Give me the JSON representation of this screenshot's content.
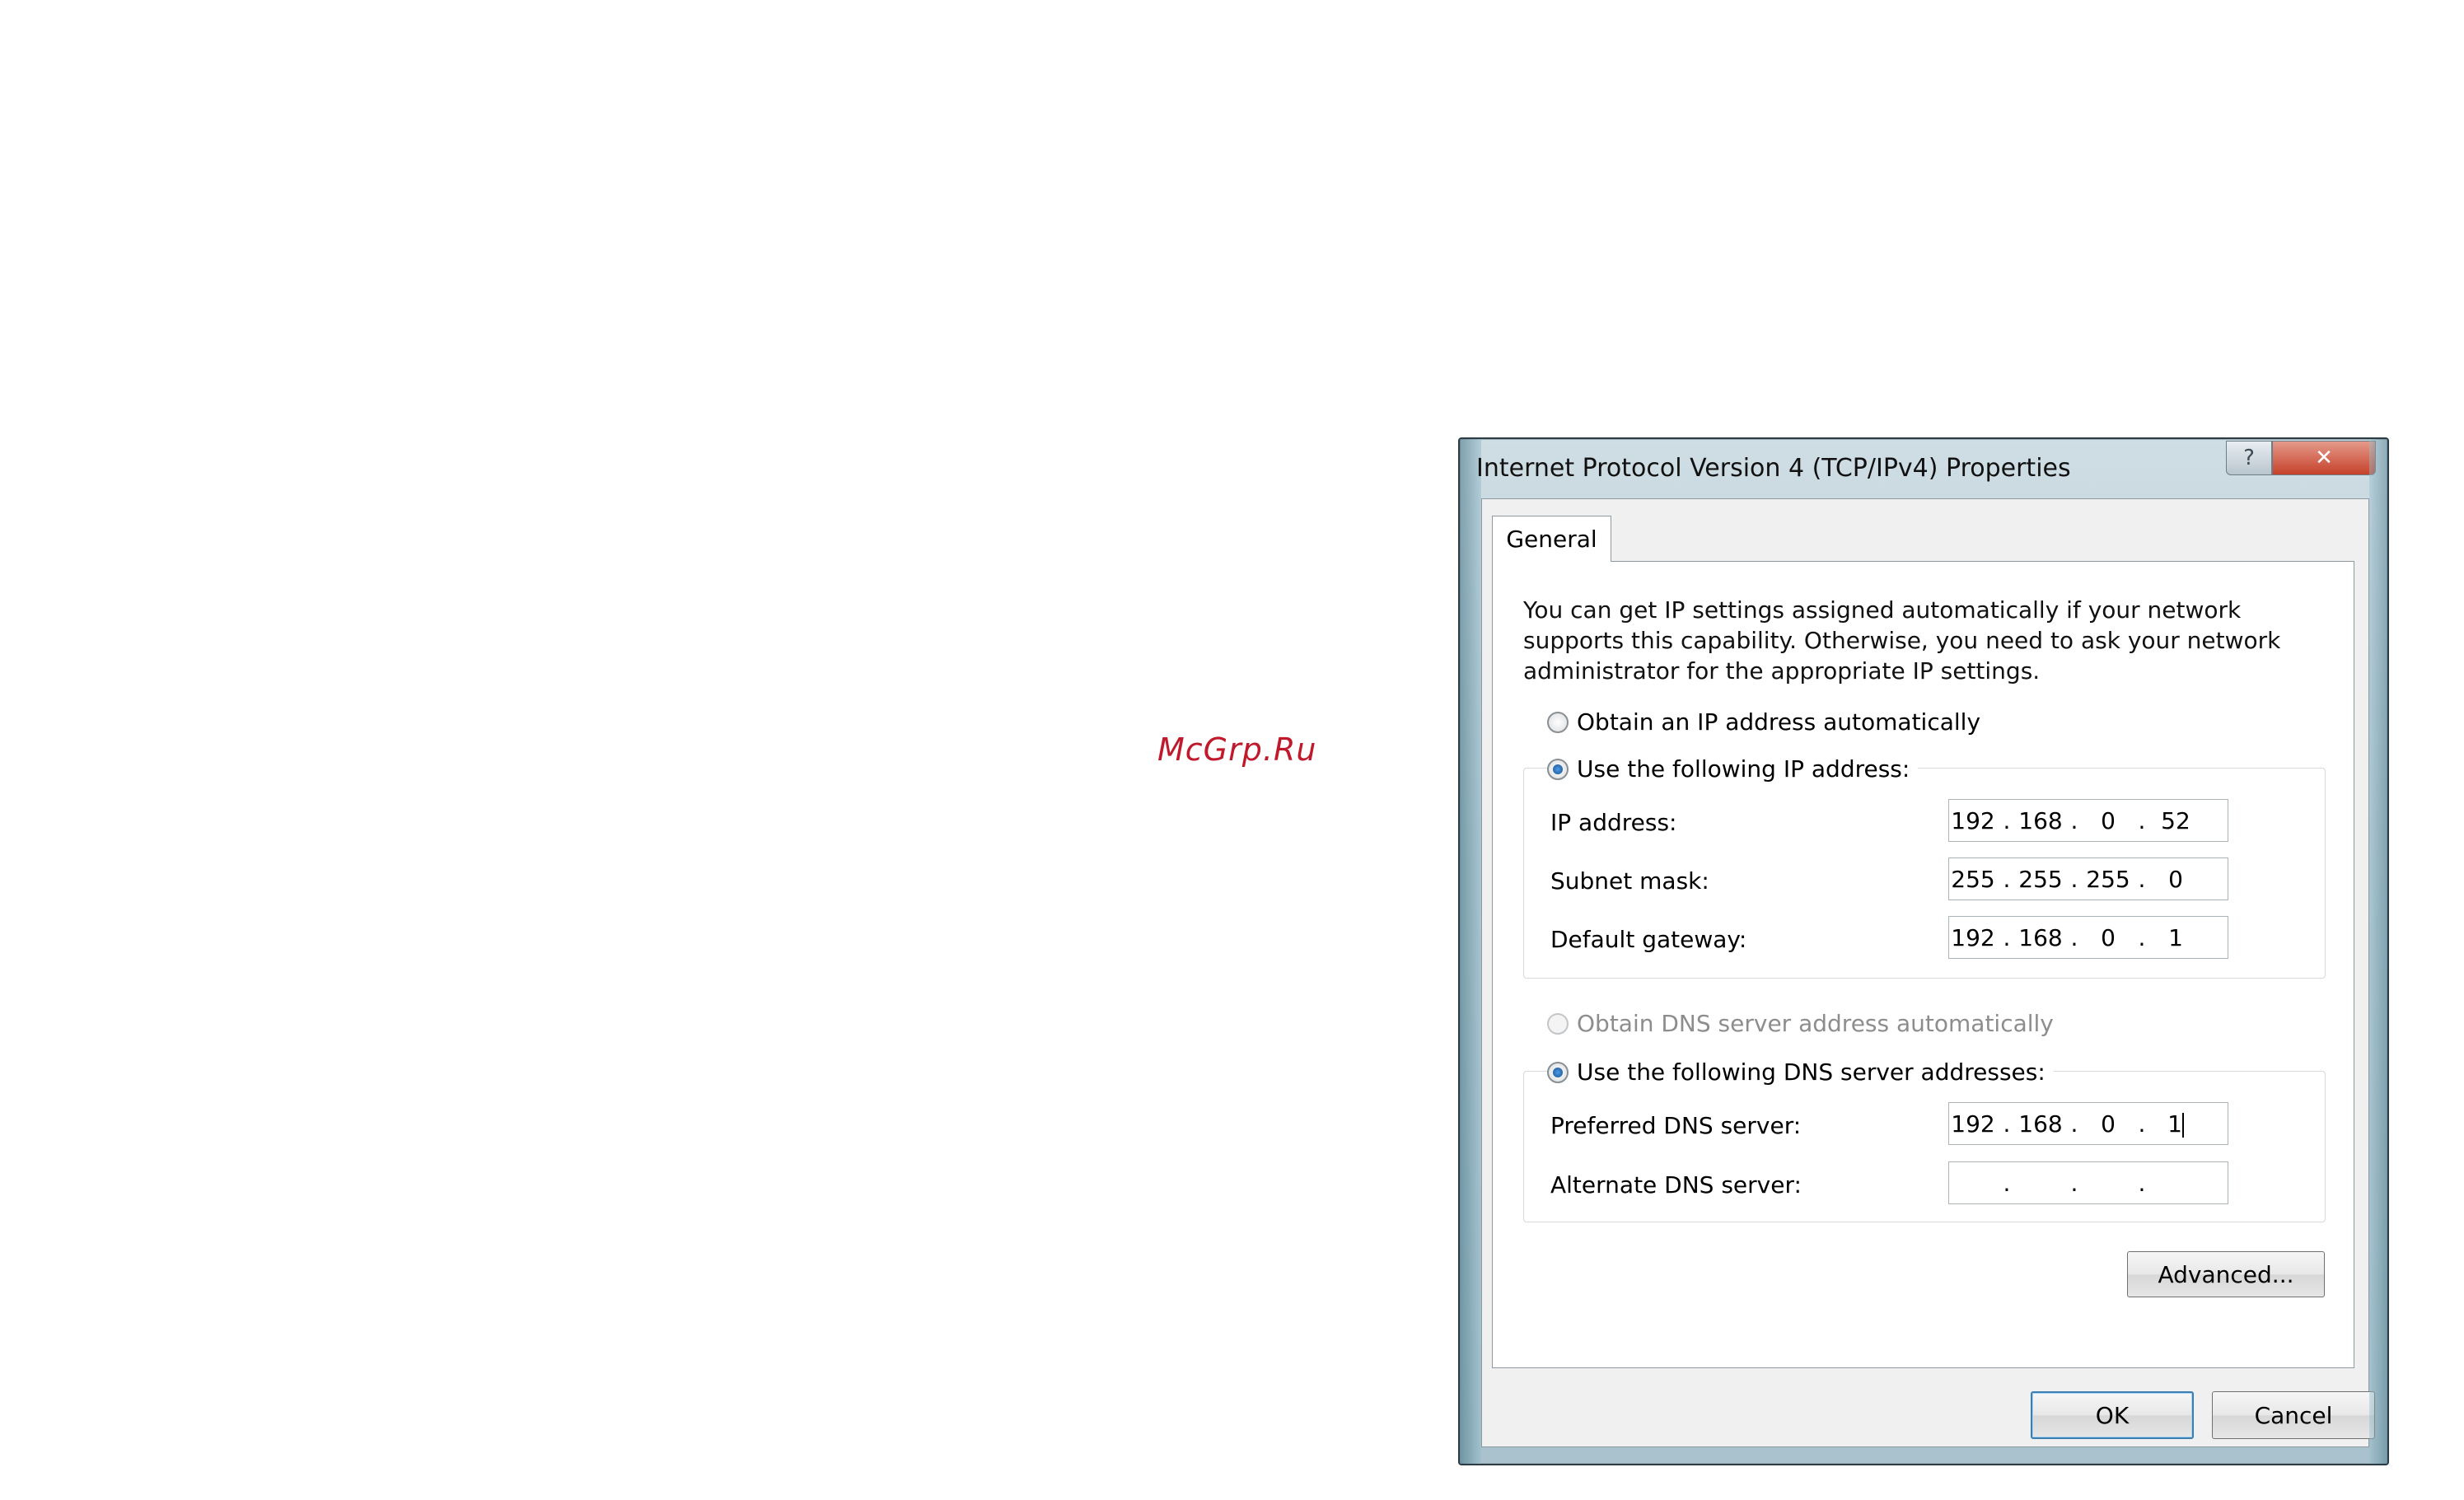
{
  "watermark": "McGrp.Ru",
  "dialog": {
    "title": "Internet Protocol Version 4 (TCP/IPv4) Properties",
    "help_glyph": "?",
    "close_glyph": "✕",
    "tab": "General",
    "description": "You can get IP settings assigned automatically if your network supports this capability. Otherwise, you need to ask your network administrator for the appropriate IP settings.",
    "ip_auto": {
      "label": "Obtain an IP address automatically",
      "selected": false
    },
    "ip_manual": {
      "label": "Use the following IP address:",
      "selected": true
    },
    "ip_fields": [
      {
        "label": "IP address:",
        "octets": [
          "192",
          "168",
          "0",
          "52"
        ]
      },
      {
        "label": "Subnet mask:",
        "octets": [
          "255",
          "255",
          "255",
          "0"
        ]
      },
      {
        "label": "Default gateway:",
        "octets": [
          "192",
          "168",
          "0",
          "1"
        ]
      }
    ],
    "dns_auto": {
      "label": "Obtain DNS server address automatically",
      "selected": false,
      "disabled": true
    },
    "dns_manual": {
      "label": "Use the following DNS server addresses:",
      "selected": true
    },
    "dns_fields": [
      {
        "label": "Preferred DNS server:",
        "octets": [
          "192",
          "168",
          "0",
          "1"
        ]
      },
      {
        "label": "Alternate DNS server:",
        "octets": [
          "",
          "",
          "",
          ""
        ]
      }
    ],
    "advanced_button": "Advanced...",
    "ok_button": "OK",
    "cancel_button": "Cancel"
  }
}
